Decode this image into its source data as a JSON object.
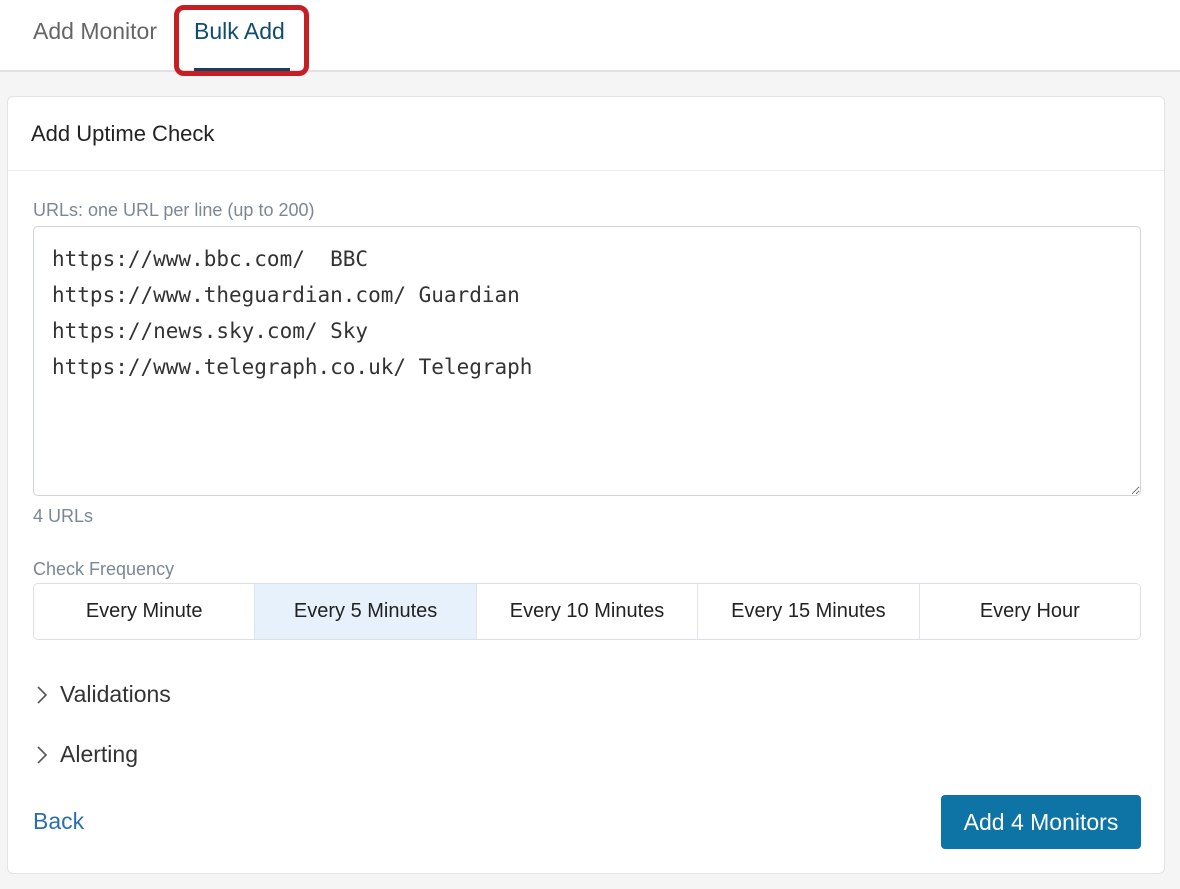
{
  "tabs": {
    "add_monitor": "Add Monitor",
    "bulk_add": "Bulk Add"
  },
  "card": {
    "title": "Add Uptime Check"
  },
  "urls": {
    "label": "URLs: one URL per line (up to 200)",
    "value": "https://www.bbc.com/  BBC\nhttps://www.theguardian.com/ Guardian\nhttps://news.sky.com/ Sky\nhttps://www.telegraph.co.uk/ Telegraph",
    "count": "4 URLs"
  },
  "frequency": {
    "label": "Check Frequency",
    "options": [
      "Every Minute",
      "Every 5 Minutes",
      "Every 10 Minutes",
      "Every 15 Minutes",
      "Every Hour"
    ],
    "selected": "Every 5 Minutes"
  },
  "sections": {
    "validations": "Validations",
    "alerting": "Alerting"
  },
  "actions": {
    "back": "Back",
    "submit": "Add 4 Monitors"
  },
  "colors": {
    "accent": "#0e74a6",
    "selected_option": "#e6f1fc",
    "highlight": "#c51f24",
    "link": "#2a6eb0"
  }
}
